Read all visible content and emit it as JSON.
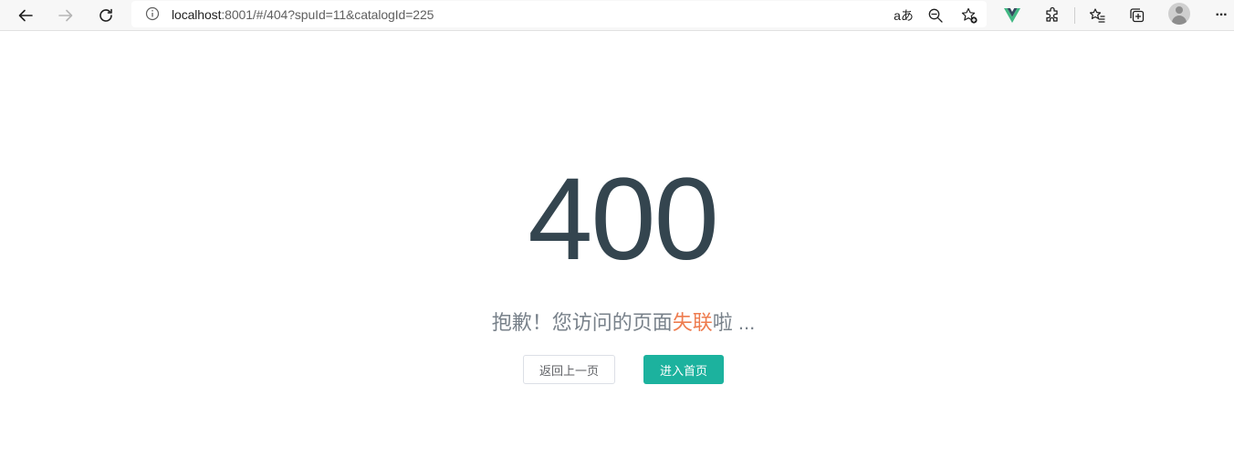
{
  "browser": {
    "url_host": "localhost",
    "url_rest": ":8001/#/404?spuId=11&catalogId=225",
    "icons": {
      "back": "back-arrow-icon",
      "forward": "forward-arrow-icon",
      "refresh": "refresh-icon",
      "info": "info-icon",
      "read_aloud": "read-aloud-icon",
      "zoom": "zoom-out-icon",
      "favorite": "add-favorite-icon",
      "vue_devtools": "vue-extension-icon",
      "extensions": "extensions-icon",
      "favorites": "favorites-icon",
      "collections": "collections-icon",
      "profile": "profile-avatar-icon",
      "menu": "more-menu-icon"
    },
    "read_aloud_label": "aあ",
    "menu_label": "···"
  },
  "page": {
    "code": "400",
    "message_prefix": "抱歉！您访问的页面",
    "message_highlight": "失联",
    "message_suffix": "啦 ...",
    "back_button_label": "返回上一页",
    "home_button_label": "进入首页"
  },
  "colors": {
    "code": "#34454f",
    "message": "#78818a",
    "highlight": "#ee7c4f",
    "primary": "#1cb29e"
  }
}
